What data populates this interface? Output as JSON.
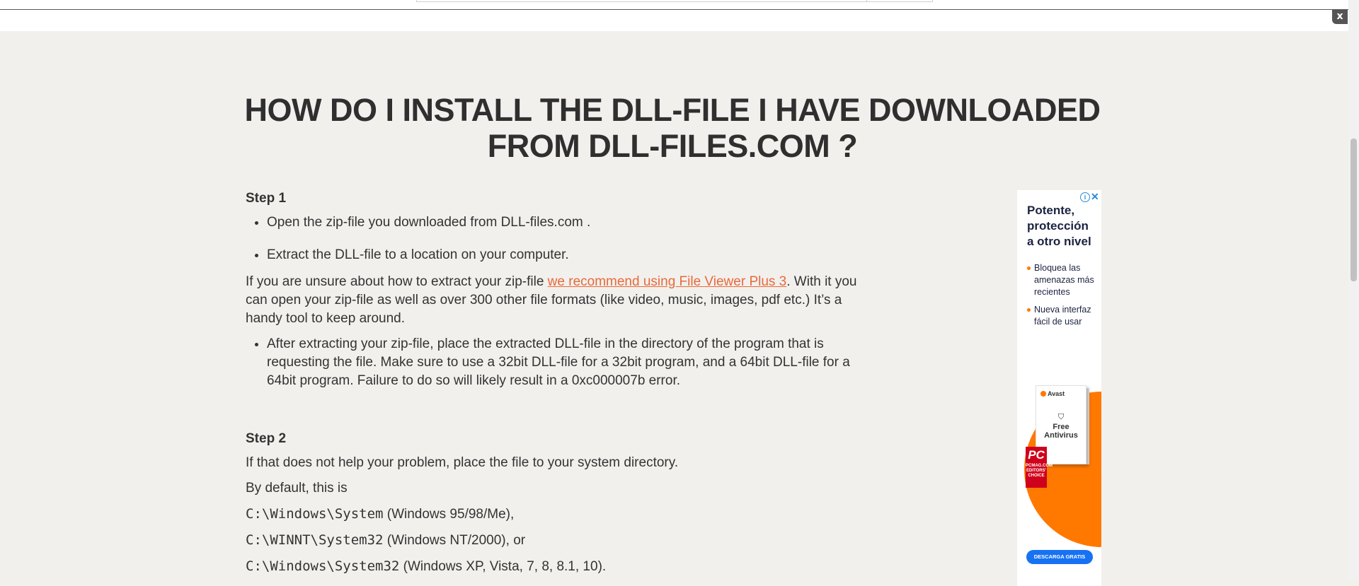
{
  "window": {
    "close_label": "x"
  },
  "article": {
    "title": "HOW DO I INSTALL THE DLL-FILE I HAVE DOWNLOADED FROM DLL-FILES.COM ?",
    "step1": {
      "heading": "Step 1",
      "bullets": [
        "Open the zip-file you downloaded from DLL-files.com .",
        "Extract the DLL-file to a location on your computer."
      ],
      "paragraph_before_link": "If you are unsure about how to extract your zip-file ",
      "link_text": "we recommend using File Viewer Plus 3",
      "paragraph_after_link": ". With it you can open your zip-file as well as over 300 other file formats (like video, music, images, pdf etc.) It’s a handy tool to keep around.",
      "bullet3": "After extracting your zip-file, place the extracted DLL-file in the directory of the program that is requesting the file. Make sure to use a 32bit DLL-file for a 32bit program, and a 64bit DLL-file for a 64bit program. Failure to do so will likely result in a 0xc000007b error."
    },
    "step2": {
      "heading": "Step 2",
      "text1": "If that does not help your problem, place the file to your system directory.",
      "text2": "By default, this is",
      "paths": [
        {
          "path": "C:\\Windows\\System",
          "note": " (Windows 95/98/Me),"
        },
        {
          "path": "C:\\WINNT\\System32",
          "note": " (Windows NT/2000), or"
        },
        {
          "path": "C:\\Windows\\System32",
          "note": " (Windows XP, Vista, 7, 8, 8.1, 10)."
        }
      ]
    }
  },
  "ad": {
    "info_icon": "info-icon",
    "close_icon": "close-icon",
    "headline": "Potente, protección a otro nivel",
    "bullets": [
      "Bloquea las amenazas más recientes",
      "Nueva interfaz fácil de usar"
    ],
    "box_brand": "Avast",
    "box_title": "Free Antivirus",
    "badge_logo": "PC",
    "badge_text": "PCMAG.COM EDITORS' CHOICE",
    "button_label": "DESCARGA GRATIS",
    "colors": {
      "accent": "#ff7800",
      "button": "#1672f3",
      "headline": "#1b2340"
    }
  },
  "colors": {
    "link": "#e76a3b",
    "background": "#f2f0ed",
    "heading": "#2f2f2f"
  }
}
